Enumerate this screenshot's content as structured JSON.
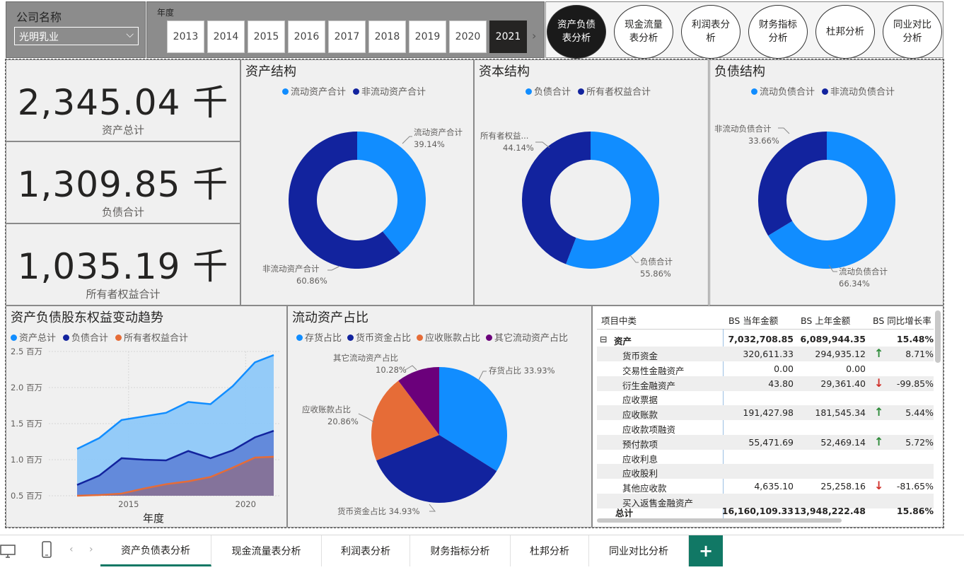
{
  "filters": {
    "company_label": "公司名称",
    "company_value": "光明乳业",
    "year_label": "年度",
    "years": [
      "2013",
      "2014",
      "2015",
      "2016",
      "2017",
      "2018",
      "2019",
      "2020",
      "2021"
    ],
    "selected_year": "2021"
  },
  "nav_buttons": [
    "资产负债表分析",
    "现金流量表分析",
    "利润表分析",
    "财务指标分析",
    "杜邦分析",
    "同业对比分析"
  ],
  "active_nav": "资产负债表分析",
  "kpis": [
    {
      "value": "2,345.04 千",
      "label": "资产总计"
    },
    {
      "value": "1,309.85 千",
      "label": "负债合计"
    },
    {
      "value": "1,035.19 千",
      "label": "所有者权益合计"
    }
  ],
  "colors": {
    "light_blue": "#118dff",
    "dark_blue": "#12239e",
    "orange": "#e66c37",
    "purple": "#6b007b",
    "green_arrow": "#2e8b3a",
    "red_arrow": "#d0302a"
  },
  "chart_data": [
    {
      "type": "pie",
      "variant": "donut",
      "title": "资产结构",
      "legend": [
        "流动资产合计",
        "非流动资产合计"
      ],
      "labels": [
        "流动资产合计",
        "非流动资产合计"
      ],
      "values": [
        39.14,
        60.86
      ],
      "value_labels": [
        "39.14%",
        "60.86%"
      ]
    },
    {
      "type": "pie",
      "variant": "donut",
      "title": "资本结构",
      "legend": [
        "负债合计",
        "所有者权益合计"
      ],
      "labels": [
        "负债合计",
        "所有者权益..."
      ],
      "values": [
        55.86,
        44.14
      ],
      "value_labels": [
        "55.86%",
        "44.14%"
      ]
    },
    {
      "type": "pie",
      "variant": "donut",
      "title": "负债结构",
      "legend": [
        "流动负债合计",
        "非流动负债合计"
      ],
      "labels": [
        "流动负债合计",
        "非流动负债合计"
      ],
      "values": [
        66.34,
        33.66
      ],
      "value_labels": [
        "66.34%",
        "33.66%"
      ]
    },
    {
      "type": "area",
      "title": "资产负债股东权益变动趋势",
      "xlabel": "年度",
      "x": [
        2013,
        2014,
        2015,
        2016,
        2017,
        2018,
        2019,
        2020,
        2021
      ],
      "x_ticks": [
        "2015",
        "2020"
      ],
      "x_tick_values": [
        2015,
        2020
      ],
      "y_ticks": [
        "2.5 百万",
        "2.0 百万",
        "1.5 百万",
        "1.0 百万",
        "0.5 百万"
      ],
      "y_tick_values": [
        2.5,
        2.0,
        1.5,
        1.0,
        0.5
      ],
      "ylim": [
        0.5,
        2.5
      ],
      "series": [
        {
          "name": "资产总计",
          "values": [
            1.15,
            1.3,
            1.55,
            1.6,
            1.65,
            1.8,
            1.77,
            2.02,
            2.35,
            2.45
          ]
        },
        {
          "name": "负债合计",
          "values": [
            0.65,
            0.78,
            1.02,
            1.0,
            0.99,
            1.12,
            1.02,
            1.13,
            1.31,
            1.4
          ]
        },
        {
          "name": "所有者权益合计",
          "values": [
            0.5,
            0.51,
            0.53,
            0.6,
            0.66,
            0.7,
            0.76,
            0.89,
            1.03,
            1.04
          ]
        }
      ],
      "x_points": [
        2012.8,
        2013.75,
        2014.7,
        2015.65,
        2016.6,
        2017.55,
        2018.5,
        2019.45,
        2020.4,
        2021.2
      ]
    },
    {
      "type": "pie",
      "title": "流动资产占比",
      "legend": [
        "存货占比",
        "货币资金占比",
        "应收账款占比",
        "其它流动资产占比"
      ],
      "labels": [
        "存货占比",
        "货币资金占比",
        "应收账款占比",
        "其它流动资产占比"
      ],
      "values": [
        33.93,
        34.93,
        20.86,
        10.28
      ],
      "value_labels": [
        "33.93%",
        "34.93%",
        "20.86%",
        "10.28%"
      ]
    }
  ],
  "table": {
    "headers": [
      "项目中类",
      "BS 当年金额",
      "BS 上年金额",
      "BS 同比增长率"
    ],
    "group": {
      "expander": "⊟",
      "label": "资产",
      "current": "7,032,708.85",
      "prior": "6,089,944.35",
      "growth": "15.48%"
    },
    "rows": [
      {
        "label": "货币资金",
        "current": "320,611.33",
        "prior": "294,935.12",
        "arrow": "up",
        "growth": "8.71%"
      },
      {
        "label": "交易性金融资产",
        "current": "0.00",
        "prior": "0.00",
        "arrow": "",
        "growth": ""
      },
      {
        "label": "衍生金融资产",
        "current": "43.80",
        "prior": "29,361.40",
        "arrow": "down",
        "growth": "-99.85%"
      },
      {
        "label": "应收票据",
        "current": "",
        "prior": "",
        "arrow": "",
        "growth": ""
      },
      {
        "label": "应收账款",
        "current": "191,427.98",
        "prior": "181,545.34",
        "arrow": "up",
        "growth": "5.44%"
      },
      {
        "label": "应收款项融资",
        "current": "",
        "prior": "",
        "arrow": "",
        "growth": ""
      },
      {
        "label": "预付款项",
        "current": "55,471.69",
        "prior": "52,469.14",
        "arrow": "up",
        "growth": "5.72%"
      },
      {
        "label": "应收利息",
        "current": "",
        "prior": "",
        "arrow": "",
        "growth": ""
      },
      {
        "label": "应收股利",
        "current": "",
        "prior": "",
        "arrow": "",
        "growth": ""
      },
      {
        "label": "其他应收款",
        "current": "4,635.10",
        "prior": "25,258.16",
        "arrow": "down",
        "growth": "-81.65%"
      },
      {
        "label": "买入返售金融资产",
        "current": "",
        "prior": "",
        "arrow": "",
        "growth": ""
      }
    ],
    "total": {
      "label": "总计",
      "current": "16,160,109.33",
      "prior": "13,948,222.48",
      "growth": "15.86%"
    }
  },
  "tabs": [
    "资产负债表分析",
    "现金流量表分析",
    "利润表分析",
    "财务指标分析",
    "杜邦分析",
    "同业对比分析"
  ],
  "active_tab": "资产负债表分析",
  "add_tab": "+",
  "icons": {
    "desktop": "desktop-icon",
    "phone": "phone-icon",
    "prev": "‹",
    "next": "›"
  }
}
